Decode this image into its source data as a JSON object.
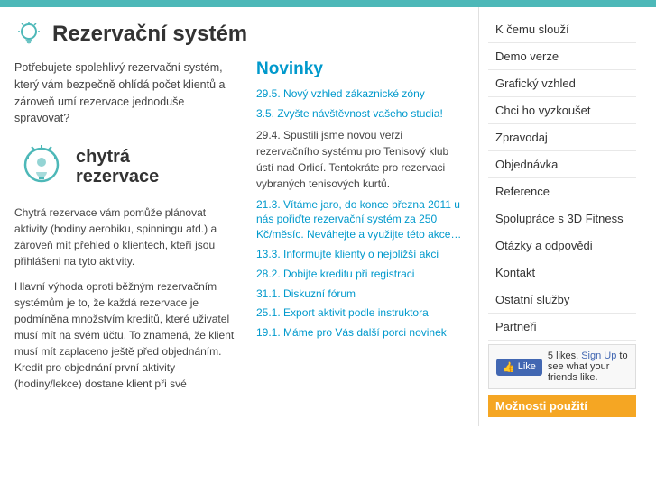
{
  "topbar": {},
  "header": {
    "title": "Rezervační systém",
    "icon_label": "bulb-icon"
  },
  "intro": {
    "text": "Potřebujete spolehlivý rezervační systém, který vám bezpečně ohlídá počet klientů a zároveň umí rezervace jednoduše spravovat?"
  },
  "logo": {
    "line1": "chytrá",
    "line2": "rezervace"
  },
  "body_texts": [
    "Chytrá rezervace vám pomůže plánovat aktivity (hodiny aerobiku, spinningu atd.) a zároveň mít přehled o klientech, kteří jsou přihlášeni na tyto aktivity.",
    "Hlavní výhoda oproti běžným rezervačním systémům je to, že každá rezervace je podmíněna množstvím kreditů, které uživatel musí mít na svém účtu. To znamená, že klient musí mít zaplaceno ještě před objednáním. Kredit pro objednání první aktivity (hodiny/lekce) dostane klient při své"
  ],
  "novinky": {
    "title": "Novinky",
    "links": [
      {
        "text": "29.5. Nový vzhled zákaznické zóny",
        "href": "#"
      },
      {
        "text": "3.5. Zvyšte návštěvnost vašeho studia!",
        "href": "#"
      }
    ],
    "news_text": "29.4. Spustili jsme novou verzi rezervačního systému pro Tenisový klub ústí nad Orlicí. Tentokráte pro rezervaci vybraných tenisových kurtů.",
    "more_links": [
      {
        "text": "21.3. Vítáme jaro, do konce března 2011 u nás pořiďte rezervační systém za 250 Kč/měsíc. Neváhejte a využijte této akce…",
        "href": "#"
      },
      {
        "text": "13.3. Informujte klienty o nejbližší akci",
        "href": "#"
      },
      {
        "text": "28.2. Dobijte kreditu při registraci",
        "href": "#"
      },
      {
        "text": "31.1. Diskuzní fórum",
        "href": "#"
      },
      {
        "text": "25.1. Export aktivit podle instruktora",
        "href": "#"
      },
      {
        "text": "19.1. Máme pro Vás další porci novinek",
        "href": "#"
      }
    ]
  },
  "sidebar": {
    "items": [
      {
        "label": "K čemu slouží",
        "id": "k-cemu-slouzi"
      },
      {
        "label": "Demo verze",
        "id": "demo-verze"
      },
      {
        "label": "Grafický vzhled",
        "id": "graficky-vzhled"
      },
      {
        "label": "Chci ho vyzkoušet",
        "id": "chci-ho-vyzkouset"
      },
      {
        "label": "Zpravodaj",
        "id": "zpravodaj"
      },
      {
        "label": "Objednávka",
        "id": "objednavka"
      },
      {
        "label": "Reference",
        "id": "reference"
      },
      {
        "label": "Spolupráce s 3D Fitness",
        "id": "spoluprace-3d"
      },
      {
        "label": "Otázky a odpovědi",
        "id": "otazky-odpovedi"
      },
      {
        "label": "Kontakt",
        "id": "kontakt"
      },
      {
        "label": "Ostatní služby",
        "id": "ostatni-sluzby"
      },
      {
        "label": "Partneři",
        "id": "partneri"
      }
    ],
    "fb": {
      "likes": "5 likes.",
      "signup_text": "Sign Up",
      "see_text": "to see what your friends like."
    },
    "moznosti": "Možnosti použití"
  }
}
